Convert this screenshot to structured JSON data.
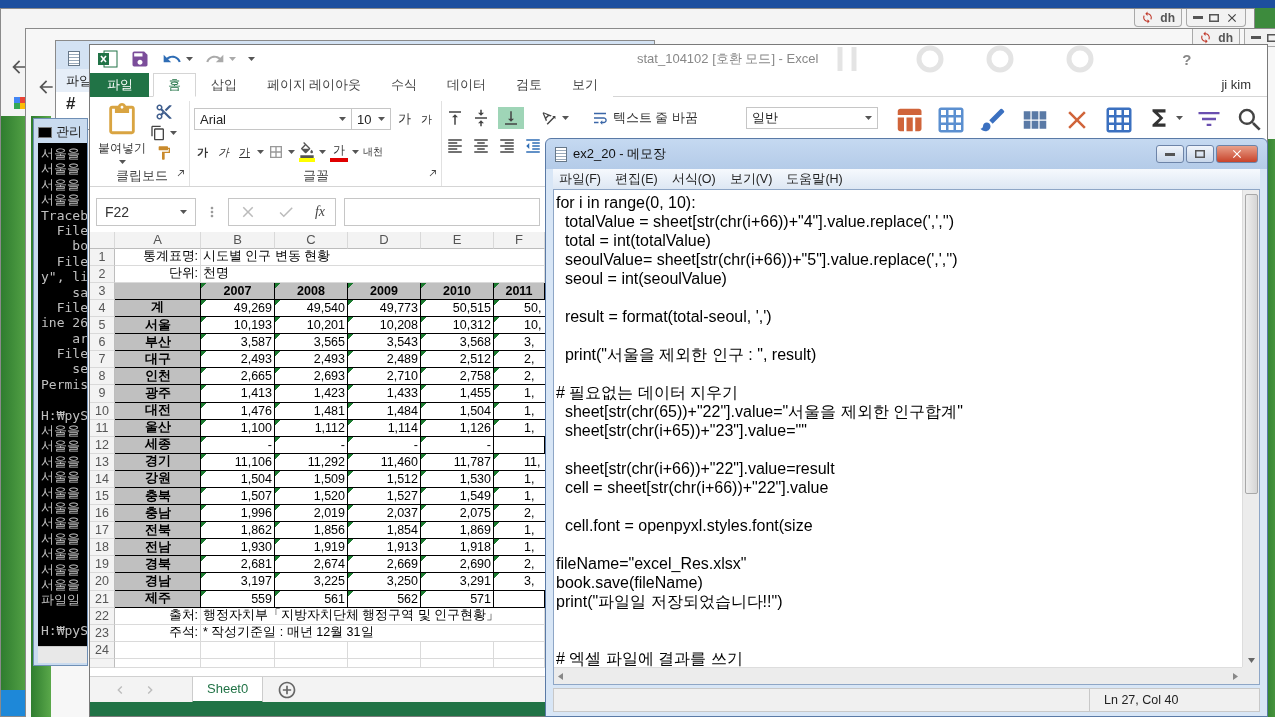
{
  "back_windows": [
    {
      "badge": "dh"
    },
    {
      "badge": "dh"
    }
  ],
  "back_notepad": {
    "menu": "파일",
    "text": "#"
  },
  "console": {
    "title": "관리",
    "text": "서울을\n서울을\n서울을\n서울을\nTraceb\n  File\n    bo\n  File\ny\", li\n    sa\n  File\nine 26\n    ar\n  File\n    se\nPermis\n\nH:₩pyS\n서울을\n서울을\n서울을\n서울을\n서울을\n서울을\n서울을\n서울을\n서울을\n서울을\n서울을\n파일일\n\nH:₩pyS"
  },
  "excel": {
    "title": "stat_104102  [호환 모드] - Excel",
    "help": "?",
    "user": "ji kim",
    "tabs": [
      {
        "label": "파일",
        "kind": "file",
        "selected": false
      },
      {
        "label": "홈",
        "kind": "tab",
        "selected": true
      },
      {
        "label": "삽입",
        "kind": "tab",
        "selected": false
      },
      {
        "label": "페이지 레이아웃",
        "kind": "tab",
        "selected": false
      },
      {
        "label": "수식",
        "kind": "tab",
        "selected": false
      },
      {
        "label": "데이터",
        "kind": "tab",
        "selected": false
      },
      {
        "label": "검토",
        "kind": "tab",
        "selected": false
      },
      {
        "label": "보기",
        "kind": "tab",
        "selected": false
      }
    ],
    "ribbon": {
      "paste": "붙여넣기",
      "clipboard_label": "클립보드",
      "font": "Arial",
      "size": "10",
      "grow": "가",
      "shrink": "가",
      "bold": "가",
      "italic": "가",
      "underline": "가",
      "font_color": "가",
      "phonetic": "내천",
      "font_label": "글꼴",
      "wrap_text": "텍스트 줄 바꿈",
      "number_format": "일반"
    },
    "name_box": "F22",
    "fx": "fx",
    "columns": [
      "A",
      "B",
      "C",
      "D",
      "E",
      "F"
    ],
    "rows": [
      {
        "kind": "info",
        "number": "1",
        "label": "통계표명:",
        "value": "시도별 인구 변동 현황"
      },
      {
        "kind": "info",
        "number": "2",
        "label": "단위:",
        "value": "천명"
      },
      {
        "kind": "header",
        "number": "3",
        "values": [
          "2007",
          "2008",
          "2009",
          "2010",
          "2011"
        ]
      },
      {
        "kind": "data",
        "number": "4",
        "region": "계",
        "values": [
          "49,269",
          "49,540",
          "49,773",
          "50,515",
          "50,"
        ]
      },
      {
        "kind": "data",
        "number": "5",
        "region": "서울",
        "values": [
          "10,193",
          "10,201",
          "10,208",
          "10,312",
          "10,"
        ]
      },
      {
        "kind": "data",
        "number": "6",
        "region": "부산",
        "values": [
          "3,587",
          "3,565",
          "3,543",
          "3,568",
          "3,"
        ]
      },
      {
        "kind": "data",
        "number": "7",
        "region": "대구",
        "values": [
          "2,493",
          "2,493",
          "2,489",
          "2,512",
          "2,"
        ]
      },
      {
        "kind": "data",
        "number": "8",
        "region": "인천",
        "values": [
          "2,665",
          "2,693",
          "2,710",
          "2,758",
          "2,"
        ]
      },
      {
        "kind": "data",
        "number": "9",
        "region": "광주",
        "values": [
          "1,413",
          "1,423",
          "1,433",
          "1,455",
          "1,"
        ]
      },
      {
        "kind": "data",
        "number": "10",
        "region": "대전",
        "values": [
          "1,476",
          "1,481",
          "1,484",
          "1,504",
          "1,"
        ]
      },
      {
        "kind": "data",
        "number": "11",
        "region": "울산",
        "values": [
          "1,100",
          "1,112",
          "1,114",
          "1,126",
          "1,"
        ]
      },
      {
        "kind": "data",
        "number": "12",
        "region": "세종",
        "values": [
          "-",
          "-",
          "-",
          "-"
        ]
      },
      {
        "kind": "data",
        "number": "13",
        "region": "경기",
        "values": [
          "11,106",
          "11,292",
          "11,460",
          "11,787",
          "11,"
        ]
      },
      {
        "kind": "data",
        "number": "14",
        "region": "강원",
        "values": [
          "1,504",
          "1,509",
          "1,512",
          "1,530",
          "1,"
        ]
      },
      {
        "kind": "data",
        "number": "15",
        "region": "충북",
        "values": [
          "1,507",
          "1,520",
          "1,527",
          "1,549",
          "1,"
        ]
      },
      {
        "kind": "data",
        "number": "16",
        "region": "충남",
        "values": [
          "1,996",
          "2,019",
          "2,037",
          "2,075",
          "2,"
        ]
      },
      {
        "kind": "data",
        "number": "17",
        "region": "전북",
        "values": [
          "1,862",
          "1,856",
          "1,854",
          "1,869",
          "1,"
        ]
      },
      {
        "kind": "data",
        "number": "18",
        "region": "전남",
        "values": [
          "1,930",
          "1,919",
          "1,913",
          "1,918",
          "1,"
        ]
      },
      {
        "kind": "data",
        "number": "19",
        "region": "경북",
        "values": [
          "2,681",
          "2,674",
          "2,669",
          "2,690",
          "2,"
        ]
      },
      {
        "kind": "data",
        "number": "20",
        "region": "경남",
        "values": [
          "3,197",
          "3,225",
          "3,250",
          "3,291",
          "3,"
        ]
      },
      {
        "kind": "data",
        "number": "21",
        "region": "제주",
        "values": [
          "559",
          "561",
          "562",
          "571"
        ]
      },
      {
        "kind": "info",
        "number": "22",
        "label": "출처:",
        "value": "행정자치부「지방자치단체 행정구역 및 인구현황」"
      },
      {
        "kind": "info",
        "number": "23",
        "label": "주석:",
        "value": "* 작성기준일 : 매년 12월 31일"
      },
      {
        "kind": "blank",
        "number": "24"
      }
    ],
    "sheet_tabs": [
      {
        "label": "Sheet0",
        "selected": true
      }
    ]
  },
  "notepad": {
    "title": "ex2_20 - 메모장",
    "menu": [
      "파일(F)",
      "편집(E)",
      "서식(O)",
      "보기(V)",
      "도움말(H)"
    ],
    "text": "for i in range(0, 10):\n  totalValue = sheet[str(chr(i+66))+\"4\"].value.replace(',','')\n  total = int(totalValue)\n  seoulValue= sheet[str(chr(i+66))+\"5\"].value.replace(',','')\n  seoul = int(seoulValue)\n\n  result = format(total-seoul, ',')\n\n  print(\"서울을 제외한 인구 : \", result)\n\n# 필요없는 데이터 지우기\n  sheet[str(chr(65))+\"22\"].value=\"서울을 제외한 인구합계\"\n  sheet[str(chr(i+65))+\"23\"].value=\"\"\n\n  sheet[str(chr(i+66))+\"22\"].value=result\n  cell = sheet[str(chr(i+66))+\"22\"].value\n\n  cell.font = openpyxl.styles.font(size\n\nfileName=\"excel_Res.xlsx\"\nbook.save(fileName)\nprint(\"파일일 저장되었습니다!!\")\n\n\n# 엑셀 파일에 결과를 쓰기",
    "status": "Ln 27, Col 40"
  }
}
